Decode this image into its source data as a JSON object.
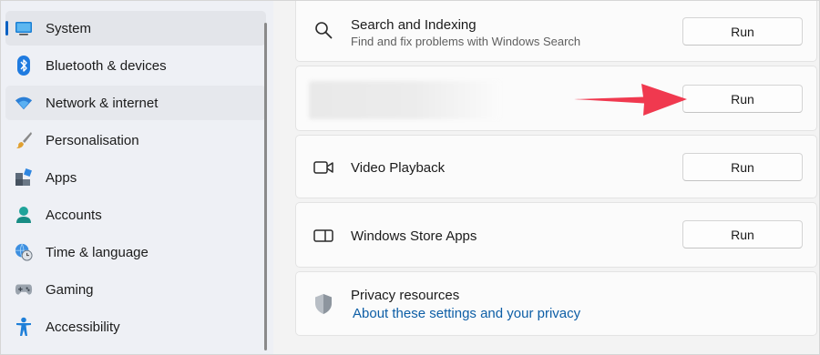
{
  "sidebar": {
    "items": [
      {
        "label": "System",
        "icon": "monitor-icon"
      },
      {
        "label": "Bluetooth & devices",
        "icon": "bluetooth-icon"
      },
      {
        "label": "Network & internet",
        "icon": "wifi-icon"
      },
      {
        "label": "Personalisation",
        "icon": "paintbrush-icon"
      },
      {
        "label": "Apps",
        "icon": "apps-icon"
      },
      {
        "label": "Accounts",
        "icon": "person-icon"
      },
      {
        "label": "Time & language",
        "icon": "globe-clock-icon"
      },
      {
        "label": "Gaming",
        "icon": "gamepad-icon"
      },
      {
        "label": "Accessibility",
        "icon": "accessibility-icon"
      }
    ],
    "selected": "System",
    "accent": "#0b61c3"
  },
  "main": {
    "search": {
      "title": "Search and Indexing",
      "desc": "Find and fix problems with Windows Search",
      "button": "Run"
    },
    "hidden_row": {
      "button": "Run"
    },
    "video": {
      "title": "Video Playback",
      "button": "Run"
    },
    "store": {
      "title": "Windows Store Apps",
      "button": "Run"
    },
    "privacy": {
      "title": "Privacy resources",
      "link": "About these settings and your privacy"
    }
  },
  "annotation": {
    "arrow_color": "#f0394f"
  }
}
